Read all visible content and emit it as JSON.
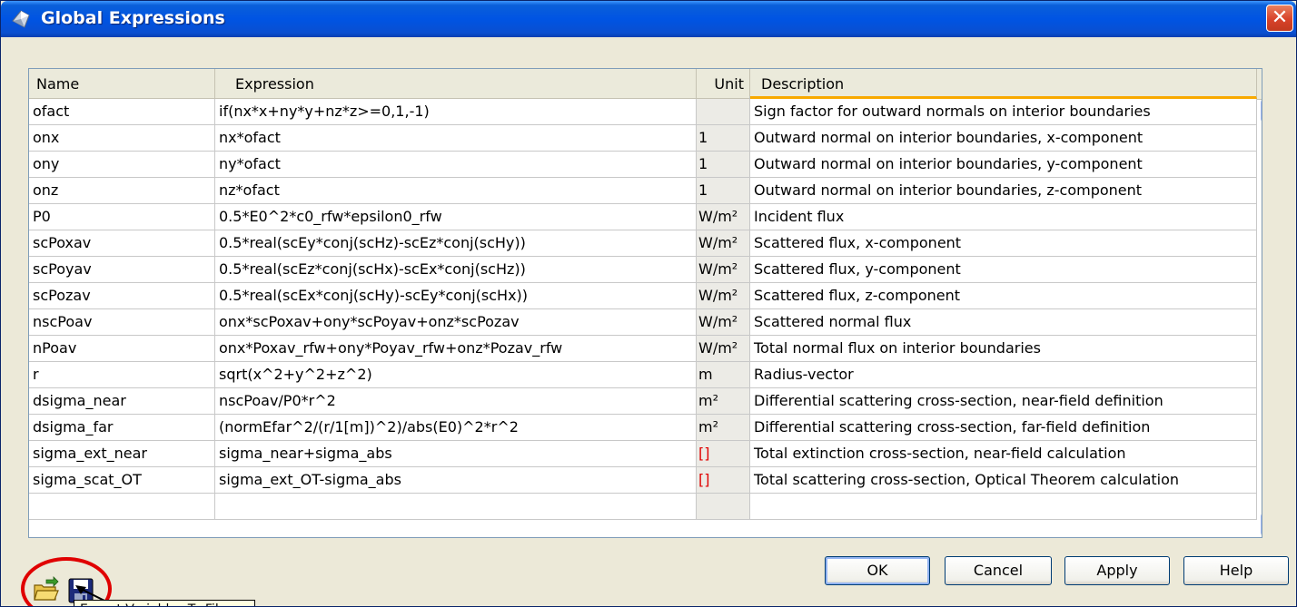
{
  "window": {
    "title": "Global Expressions",
    "close_glyph": "✕"
  },
  "table": {
    "columns": {
      "name": "Name",
      "expression": "Expression",
      "unit": "Unit",
      "description": "Description"
    },
    "rows": [
      {
        "name": "ofact",
        "expression": "if(nx*x+ny*y+nz*z>=0,1,-1)",
        "unit": "",
        "unit_red": false,
        "description": "Sign factor for outward normals on interior boundaries"
      },
      {
        "name": "onx",
        "expression": "nx*ofact",
        "unit": "1",
        "unit_red": false,
        "description": "Outward normal on interior boundaries, x-component"
      },
      {
        "name": "ony",
        "expression": "ny*ofact",
        "unit": "1",
        "unit_red": false,
        "description": "Outward normal on interior boundaries, y-component"
      },
      {
        "name": "onz",
        "expression": "nz*ofact",
        "unit": "1",
        "unit_red": false,
        "description": "Outward normal on interior boundaries, z-component"
      },
      {
        "name": "P0",
        "expression": "0.5*E0^2*c0_rfw*epsilon0_rfw",
        "unit": "W/m²",
        "unit_red": false,
        "description": "Incident flux"
      },
      {
        "name": "scPoxav",
        "expression": "0.5*real(scEy*conj(scHz)-scEz*conj(scHy))",
        "unit": "W/m²",
        "unit_red": false,
        "description": "Scattered flux, x-component"
      },
      {
        "name": "scPoyav",
        "expression": "0.5*real(scEz*conj(scHx)-scEx*conj(scHz))",
        "unit": "W/m²",
        "unit_red": false,
        "description": "Scattered flux, y-component"
      },
      {
        "name": "scPozav",
        "expression": "0.5*real(scEx*conj(scHy)-scEy*conj(scHx))",
        "unit": "W/m²",
        "unit_red": false,
        "description": "Scattered flux, z-component"
      },
      {
        "name": "nscPoav",
        "expression": "onx*scPoxav+ony*scPoyav+onz*scPozav",
        "unit": "W/m²",
        "unit_red": false,
        "description": "Scattered normal flux"
      },
      {
        "name": "nPoav",
        "expression": "onx*Poxav_rfw+ony*Poyav_rfw+onz*Pozav_rfw",
        "unit": "W/m²",
        "unit_red": false,
        "description": "Total normal flux on interior boundaries"
      },
      {
        "name": "r",
        "expression": "sqrt(x^2+y^2+z^2)",
        "unit": "m",
        "unit_red": false,
        "description": "Radius-vector"
      },
      {
        "name": "dsigma_near",
        "expression": "nscPoav/P0*r^2",
        "unit": "m²",
        "unit_red": false,
        "description": "Differential scattering cross-section, near-field definition"
      },
      {
        "name": "dsigma_far",
        "expression": "(normEfar^2/(r/1[m])^2)/abs(E0)^2*r^2",
        "unit": "m²",
        "unit_red": false,
        "description": "Differential scattering cross-section, far-field definition"
      },
      {
        "name": "sigma_ext_near",
        "expression": "sigma_near+sigma_abs",
        "unit": "[]",
        "unit_red": true,
        "description": "Total extinction cross-section, near-field calculation"
      },
      {
        "name": "sigma_scat_OT",
        "expression": "sigma_ext_OT-sigma_abs",
        "unit": "[]",
        "unit_red": true,
        "description": "Total scattering cross-section, Optical Theorem calculation"
      },
      {
        "name": "",
        "expression": "",
        "unit": "",
        "unit_red": false,
        "description": ""
      }
    ]
  },
  "toolbar": {
    "load_icon": "folder-open-icon",
    "save_icon": "floppy-disk-icon"
  },
  "tooltip": {
    "text": "Export Variables To File"
  },
  "buttons": {
    "ok": "OK",
    "cancel": "Cancel",
    "apply": "Apply",
    "help": "Help"
  },
  "colors": {
    "titlebar": "#0054e3",
    "close": "#d8432a",
    "unit_red": "#e00000",
    "highlight": "#e00000",
    "header_accent": "#f8a900"
  }
}
